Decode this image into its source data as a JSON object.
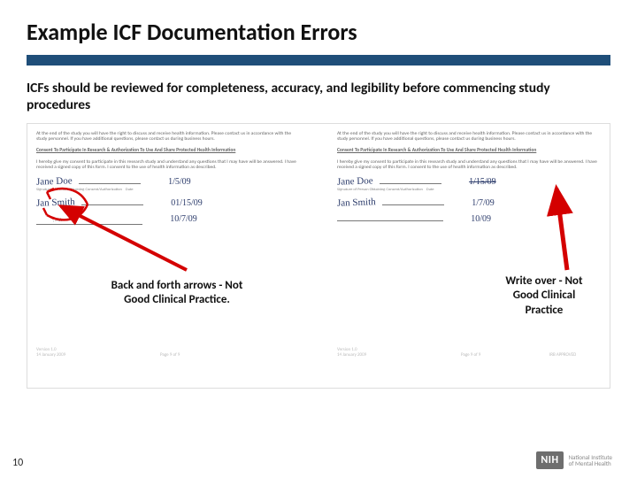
{
  "title": "Example ICF Documentation Errors",
  "lead": "ICFs should be reviewed for completeness, accuracy, and legibility before commencing study procedures",
  "docs": {
    "left": {
      "sig_name": "Jane Doe",
      "printed": "Jan Smith",
      "date1": "1/5/09",
      "date2": "01/15/09",
      "date3": "10/7/09"
    },
    "right": {
      "sig_name": "Jane Doe",
      "printed": "Jan Smith",
      "date1": "1/15/09",
      "date2": "1/7/09",
      "date3": "10/09"
    },
    "footer_left": {
      "version": "Version 1.0",
      "date": "14 January 2009",
      "page": "Page 9 of 9"
    },
    "footer_right": {
      "version": "Version 1.0",
      "date": "14 January 2009",
      "page": "Page 9 of 9",
      "stamp": "IRB APPROVED"
    }
  },
  "annotations": {
    "left": "Back and forth arrows - Not Good Clinical Practice.",
    "right": "Write over - Not Good Clinical Practice"
  },
  "page_number": "10",
  "logo": {
    "badge": "NIH",
    "line1": "National Institute",
    "line2": "of Mental Health"
  }
}
